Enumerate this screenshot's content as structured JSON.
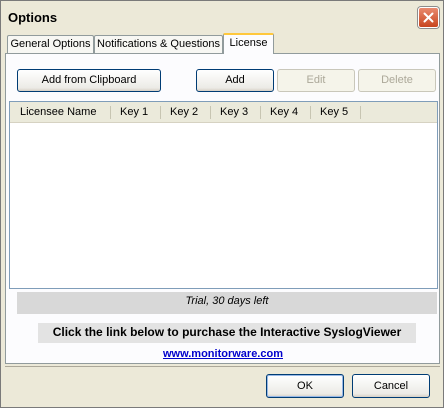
{
  "window": {
    "title": "Options",
    "close_icon": "close-icon",
    "accent_color": "#d8522a"
  },
  "tabs": [
    {
      "label": "General Options",
      "active": false
    },
    {
      "label": "Notifications & Questions",
      "active": false
    },
    {
      "label": "License",
      "active": true
    }
  ],
  "toolbar": {
    "add_from_clipboard_label": "Add from Clipboard",
    "add_label": "Add",
    "edit_label": "Edit",
    "delete_label": "Delete",
    "edit_enabled": false,
    "delete_enabled": false
  },
  "license_table": {
    "columns": [
      "Licensee Name",
      "Key 1",
      "Key 2",
      "Key 3",
      "Key 4",
      "Key 5"
    ],
    "rows": []
  },
  "status": {
    "trial_text": "Trial, 30 days left"
  },
  "purchase": {
    "prompt": "Click the link below to purchase the Interactive SyslogViewer",
    "link_text": "www.monitorware.com",
    "link_color": "#0000cc"
  },
  "footer": {
    "ok_label": "OK",
    "cancel_label": "Cancel"
  }
}
